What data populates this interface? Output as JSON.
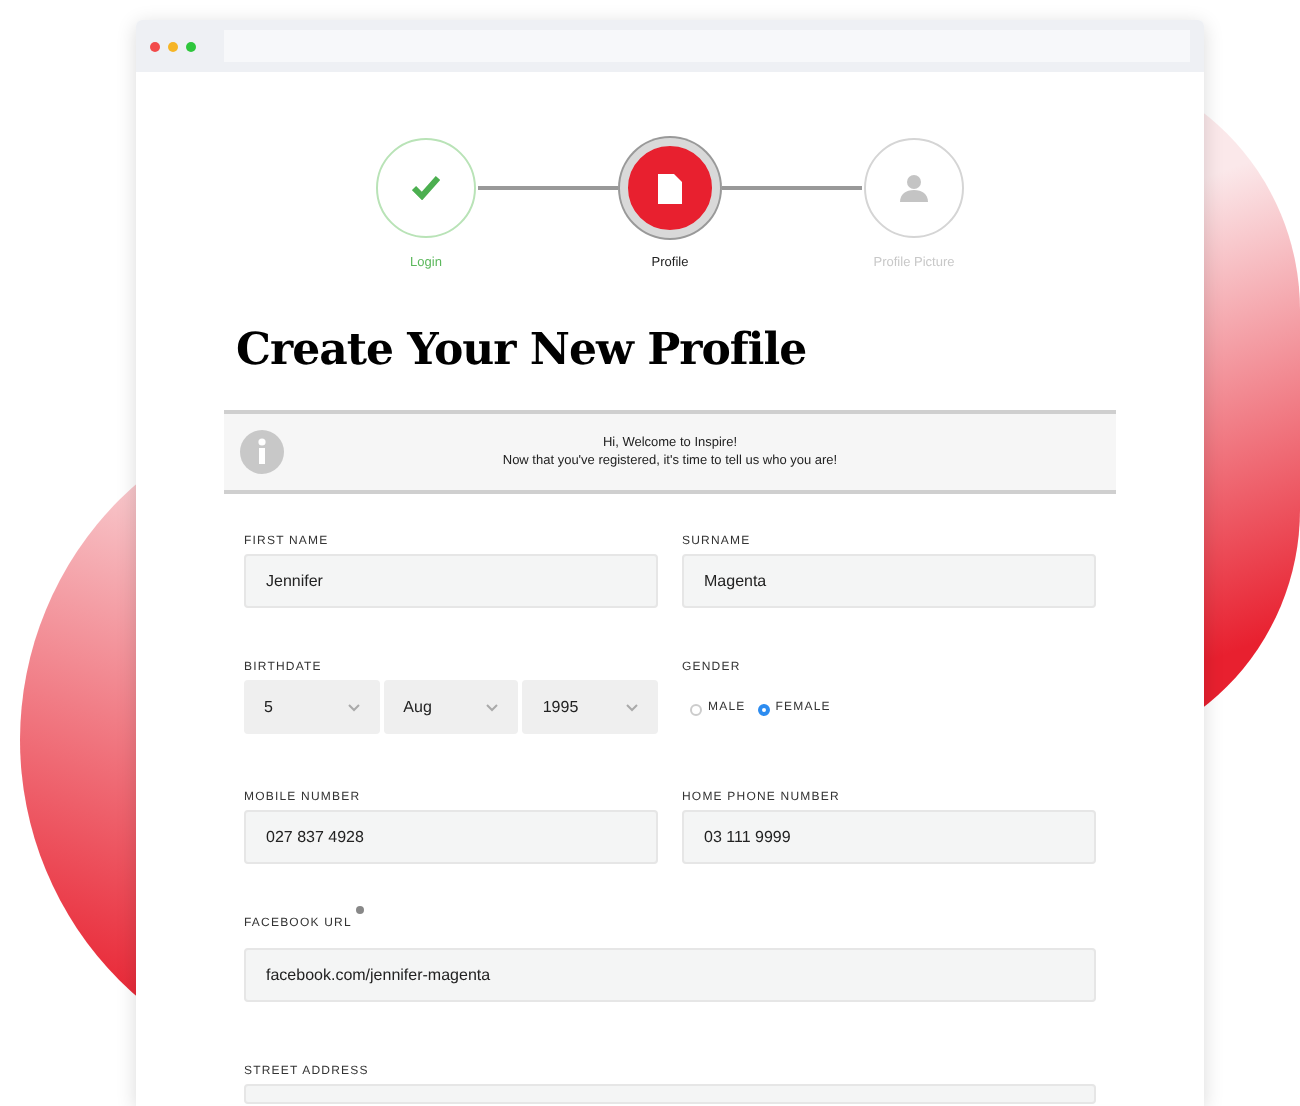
{
  "steps": [
    {
      "label": "Login",
      "kind": "done"
    },
    {
      "label": "Profile",
      "kind": "current"
    },
    {
      "label": "Profile Picture",
      "kind": "upcoming"
    }
  ],
  "heading": "Create Your New Profile",
  "notice": {
    "lines": [
      "Hi, Welcome to Inspire!",
      "Now that you've registered, it's time to tell us who you are!"
    ]
  },
  "first_name": {
    "label": "FIRST NAME",
    "value": "Jennifer"
  },
  "surname": {
    "label": "SURNAME",
    "value": "Magenta"
  },
  "birthdate": {
    "label": "BIRTHDATE",
    "selects": [
      "5",
      "Aug",
      "1995"
    ]
  },
  "gender": {
    "label": "GENDER",
    "options": [
      {
        "label": "MALE",
        "selected": false
      },
      {
        "label": "FEMALE",
        "selected": true
      }
    ]
  },
  "mobile_number": {
    "label": "MOBILE NUMBER",
    "value": "027 837 4928"
  },
  "home_phone_number": {
    "label": "HOME PHONE NUMBER",
    "value": "03 111 9999"
  },
  "facebook_url": {
    "label": "FACEBOOK URL",
    "value": "facebook.com/jennifer-magenta"
  },
  "street_address": {
    "label": "STREET ADDRESS"
  }
}
